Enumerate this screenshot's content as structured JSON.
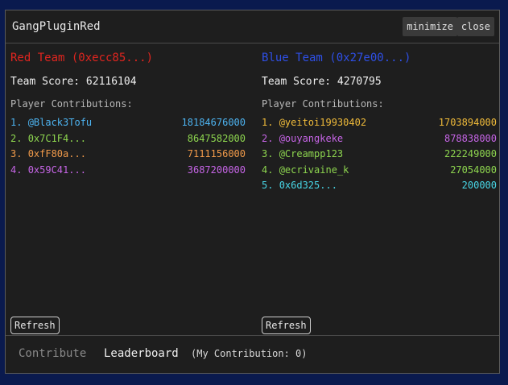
{
  "window": {
    "title": "GangPluginRed",
    "minimize_label": "minimize",
    "close_label": "close"
  },
  "teams": [
    {
      "name": "Red Team (0xecc85...)",
      "color": "#e0251f",
      "score_text": "Team Score: 62116104",
      "contributions_label": "Player Contributions:",
      "players": [
        {
          "rank": "1.",
          "name": "@Black3Tofu",
          "amount": "18184676000",
          "color": "#4db3f0"
        },
        {
          "rank": "2.",
          "name": "0x7C1F4...",
          "amount": "8647582000",
          "color": "#8ed64f"
        },
        {
          "rank": "3.",
          "name": "0xfF80a...",
          "amount": "7111156000",
          "color": "#f09a4a"
        },
        {
          "rank": "4.",
          "name": "0x59C41...",
          "amount": "3687200000",
          "color": "#c665e6"
        }
      ],
      "refresh_label": "Refresh"
    },
    {
      "name": "Blue Team (0x27e00...)",
      "color": "#2e4fe6",
      "score_text": "Team Score: 4270795",
      "contributions_label": "Player Contributions:",
      "players": [
        {
          "rank": "1.",
          "name": "@yeitoi19930402",
          "amount": "1703894000",
          "color": "#f0bb3a"
        },
        {
          "rank": "2.",
          "name": "@ouyangkeke",
          "amount": "878838000",
          "color": "#c665e6"
        },
        {
          "rank": "3.",
          "name": "@Creampp123",
          "amount": "222249000",
          "color": "#8ed64f"
        },
        {
          "rank": "4.",
          "name": "@ecrivaine_k",
          "amount": "27054000",
          "color": "#8ed64f"
        },
        {
          "rank": "5.",
          "name": "0x6d325...",
          "amount": "200000",
          "color": "#48d6e6"
        }
      ],
      "refresh_label": "Refresh"
    }
  ],
  "footer": {
    "contribute_tab": "Contribute",
    "leaderboard_tab": "Leaderboard",
    "my_contribution": "(My Contribution: 0)"
  }
}
